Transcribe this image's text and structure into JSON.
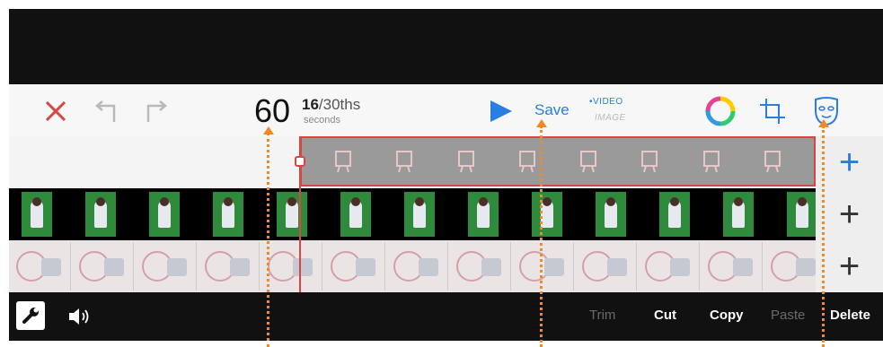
{
  "toolbar": {
    "close_icon": "x-icon",
    "undo_icon": "undo-icon",
    "redo_icon": "redo-icon",
    "counter": {
      "whole": "60",
      "numerator": "16",
      "denominator": "/30ths",
      "unit": "seconds"
    },
    "play_icon": "play-icon",
    "save_label": "Save",
    "mode_video": "•VIDEO",
    "mode_image": "IMAGE",
    "color_icon": "color-wheel-icon",
    "crop_icon": "crop-icon",
    "mask_icon": "mask-icon"
  },
  "tracks": {
    "add_labels": [
      "+",
      "+",
      "+"
    ]
  },
  "bottom_bar": {
    "settings_icon": "wrench-icon",
    "audio_icon": "speaker-icon",
    "actions": [
      {
        "label": "Trim",
        "enabled": false
      },
      {
        "label": "Cut",
        "enabled": true
      },
      {
        "label": "Copy",
        "enabled": true
      },
      {
        "label": "Paste",
        "enabled": false
      },
      {
        "label": "Delete",
        "enabled": true
      }
    ]
  },
  "colors": {
    "accent_blue": "#2a7de1",
    "selection_red": "#d84545",
    "pointer_orange": "#f08a24"
  }
}
